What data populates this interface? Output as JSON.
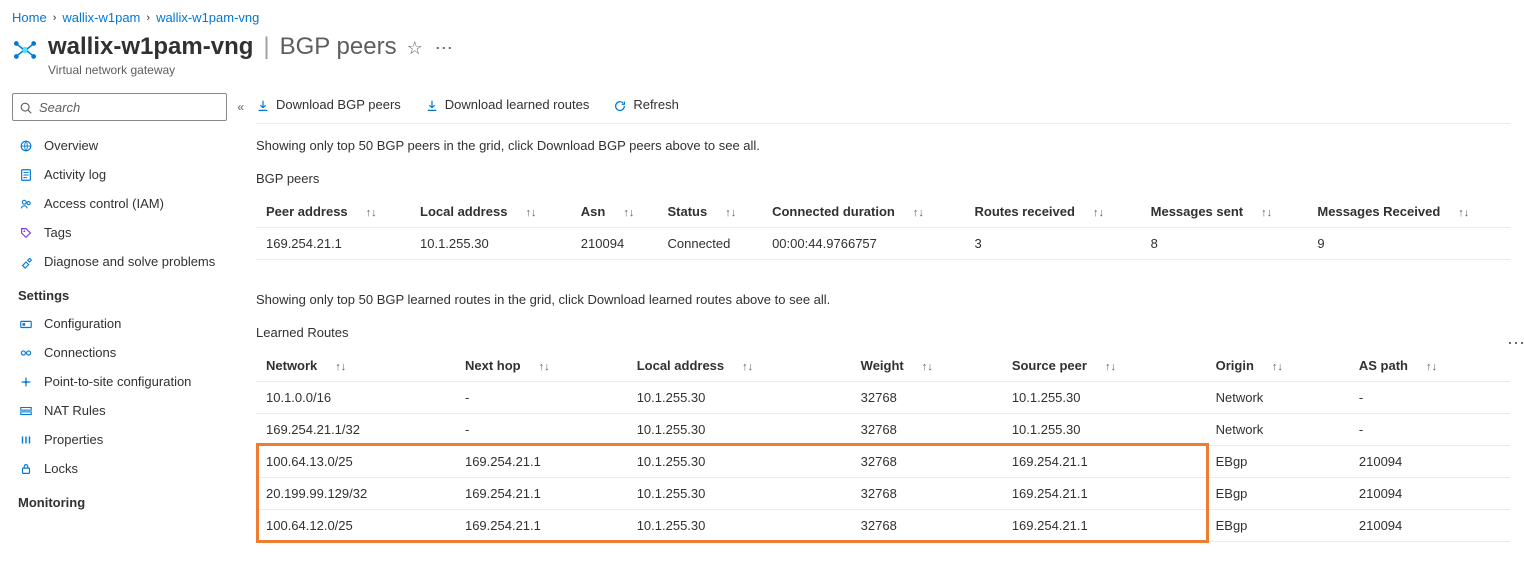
{
  "breadcrumbs": {
    "items": [
      "Home",
      "wallix-w1pam",
      "wallix-w1pam-vng"
    ]
  },
  "header": {
    "resource": "wallix-w1pam-vng",
    "page": "BGP peers",
    "kind": "Virtual network gateway"
  },
  "search": {
    "placeholder": "Search"
  },
  "nav": {
    "top": [
      {
        "label": "Overview",
        "icon": "globe",
        "color": "#0078d4"
      },
      {
        "label": "Activity log",
        "icon": "log",
        "color": "#0078d4"
      },
      {
        "label": "Access control (IAM)",
        "icon": "people",
        "color": "#0078d4"
      },
      {
        "label": "Tags",
        "icon": "tag",
        "color": "#773adc"
      },
      {
        "label": "Diagnose and solve problems",
        "icon": "wrench",
        "color": "#0078d4"
      }
    ],
    "section1": "Settings",
    "settings": [
      {
        "label": "Configuration",
        "icon": "gear",
        "color": "#0078d4"
      },
      {
        "label": "Connections",
        "icon": "link",
        "color": "#0078d4"
      },
      {
        "label": "Point-to-site configuration",
        "icon": "p2s",
        "color": "#0078d4"
      },
      {
        "label": "NAT Rules",
        "icon": "nat",
        "color": "#0078d4"
      },
      {
        "label": "Properties",
        "icon": "bars",
        "color": "#0078d4"
      },
      {
        "label": "Locks",
        "icon": "lock",
        "color": "#0078d4"
      }
    ],
    "section2": "Monitoring"
  },
  "toolbar": {
    "download_peers": "Download BGP peers",
    "download_routes": "Download learned routes",
    "refresh": "Refresh"
  },
  "peers": {
    "caption": "Showing only top 50 BGP peers in the grid, click Download BGP peers above to see all.",
    "title": "BGP peers",
    "columns": [
      "Peer address",
      "Local address",
      "Asn",
      "Status",
      "Connected duration",
      "Routes received",
      "Messages sent",
      "Messages Received"
    ],
    "rows": [
      {
        "peer": "169.254.21.1",
        "local": "10.1.255.30",
        "asn": "210094",
        "status": "Connected",
        "dur": "00:00:44.9766757",
        "recv": "3",
        "sent": "8",
        "mrecv": "9"
      }
    ]
  },
  "routes": {
    "caption": "Showing only top 50 BGP learned routes in the grid, click Download learned routes above to see all.",
    "title": "Learned Routes",
    "columns": [
      "Network",
      "Next hop",
      "Local address",
      "Weight",
      "Source peer",
      "Origin",
      "AS path"
    ],
    "rows": [
      {
        "net": "10.1.0.0/16",
        "hop": "-",
        "local": "10.1.255.30",
        "w": "32768",
        "src": "10.1.255.30",
        "orig": "Network",
        "as": "-",
        "hl": false
      },
      {
        "net": "169.254.21.1/32",
        "hop": "-",
        "local": "10.1.255.30",
        "w": "32768",
        "src": "10.1.255.30",
        "orig": "Network",
        "as": "-",
        "hl": false
      },
      {
        "net": "100.64.13.0/25",
        "hop": "169.254.21.1",
        "local": "10.1.255.30",
        "w": "32768",
        "src": "169.254.21.1",
        "orig": "EBgp",
        "as": "210094",
        "hl": true
      },
      {
        "net": "20.199.99.129/32",
        "hop": "169.254.21.1",
        "local": "10.1.255.30",
        "w": "32768",
        "src": "169.254.21.1",
        "orig": "EBgp",
        "as": "210094",
        "hl": true
      },
      {
        "net": "100.64.12.0/25",
        "hop": "169.254.21.1",
        "local": "10.1.255.30",
        "w": "32768",
        "src": "169.254.21.1",
        "orig": "EBgp",
        "as": "210094",
        "hl": true
      }
    ]
  }
}
